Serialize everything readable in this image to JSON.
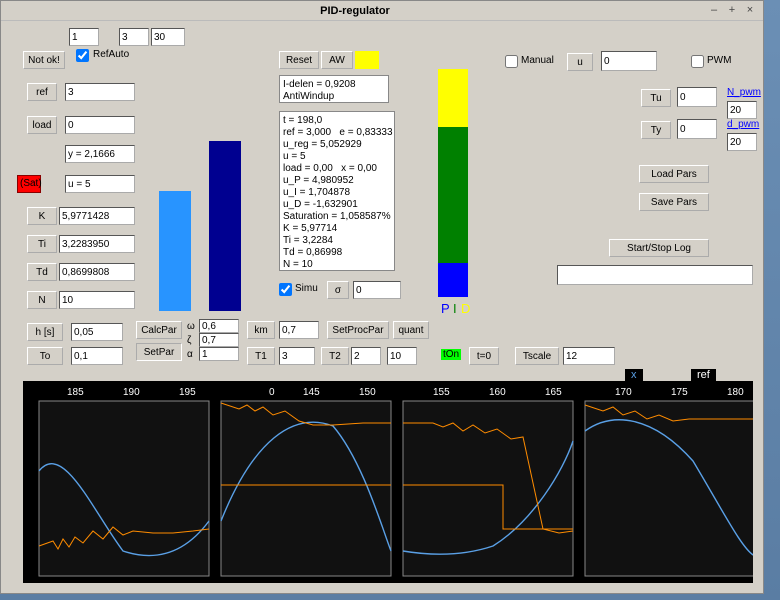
{
  "title": "PID-regulator",
  "topRow": {
    "v1": "1",
    "v2": "3",
    "v3": "30"
  },
  "notok": "Not ok!",
  "refauto_label": "RefAuto",
  "ref_btn": "ref",
  "ref_val": "3",
  "load_btn": "load",
  "load_val": "0",
  "y_val": "y = 2,1666",
  "sat_label": "(Sat)",
  "u_val": "u = 5",
  "K_btn": "K",
  "K_val": "5,9771428",
  "Ti_btn": "Ti",
  "Ti_val": "3,2283950",
  "Td_btn": "Td",
  "Td_val": "0,8699808",
  "N_btn": "N",
  "N_val": "10",
  "hs_btn": "h [s]",
  "hs_val": "0,05",
  "To_btn": "To",
  "To_val": "0,1",
  "calc_btn": "CalcPar",
  "set_btn": "SetPar",
  "omega": "ω",
  "zeta": "ζ",
  "alpha": "α",
  "omega_val": "0,6",
  "zeta_val": "0,7",
  "alpha_val": "1",
  "reset_btn": "Reset",
  "aw_btn": "AW",
  "aw2": "Aw",
  "idelen": "I-delen = 0,9208",
  "antiwindup": "AntiWindup",
  "readout": "t = 198,0\nref = 3,000   e = 0,83333\nu_reg = 5,052929\nu = 5\nload = 0,00   x = 0,00\nu_P = 4,980952\nu_I = 1,704878\nu_D = -1,632901\nSaturation = 1,058587%\nK = 5,97714\nTi = 3,2284\nTd = 0,86998\nN = 10",
  "simu_label": "Simu",
  "sigma_btn": "σ",
  "sigma_val": "0",
  "km_btn": "km",
  "km_val": "0,7",
  "setproc_btn": "SetProcPar",
  "quant_btn": "quant",
  "T1_btn": "T1",
  "T1_val": "3",
  "T2_btn": "T2",
  "T2_val": "2",
  "T2_val2": "10",
  "PID_P": "P",
  "PID_I": "I",
  "PID_D": "D",
  "tOn": "tOn",
  "t0_btn": "t=0",
  "tscale_btn": "Tscale",
  "tscale_val": "12",
  "manual_label": "Manual",
  "u_btn": "u",
  "u_input": "0",
  "pwm_label": "PWM",
  "Tu_btn": "Tu",
  "Tu_val": "0",
  "Ty_btn": "Ty",
  "Ty_val": "0",
  "npwm_link": "N_pwm",
  "npwm_val": "20",
  "dpwm_link": "d_pwm",
  "dpwm_val": "20",
  "loadpars_btn": "Load Pars",
  "savepars_btn": "Save Pars",
  "startstop_btn": "Start/Stop Log",
  "legend_x": "x",
  "legend_ref": "ref",
  "chart_data": {
    "type": "line",
    "panels": 4,
    "x_ticks": [
      [
        "185",
        "190",
        "195"
      ],
      [
        "0",
        "145",
        "150"
      ],
      [
        "155",
        "160",
        "165"
      ],
      [
        "170",
        "175",
        "180"
      ]
    ],
    "series": [
      {
        "name": "x",
        "color": "#5aa0e6"
      },
      {
        "name": "ref",
        "color": "#ff8c00"
      }
    ],
    "note": "four time-series panels showing controlled variable (blue smooth wave) and noisy reference/output (orange) oscillating with step changes"
  }
}
